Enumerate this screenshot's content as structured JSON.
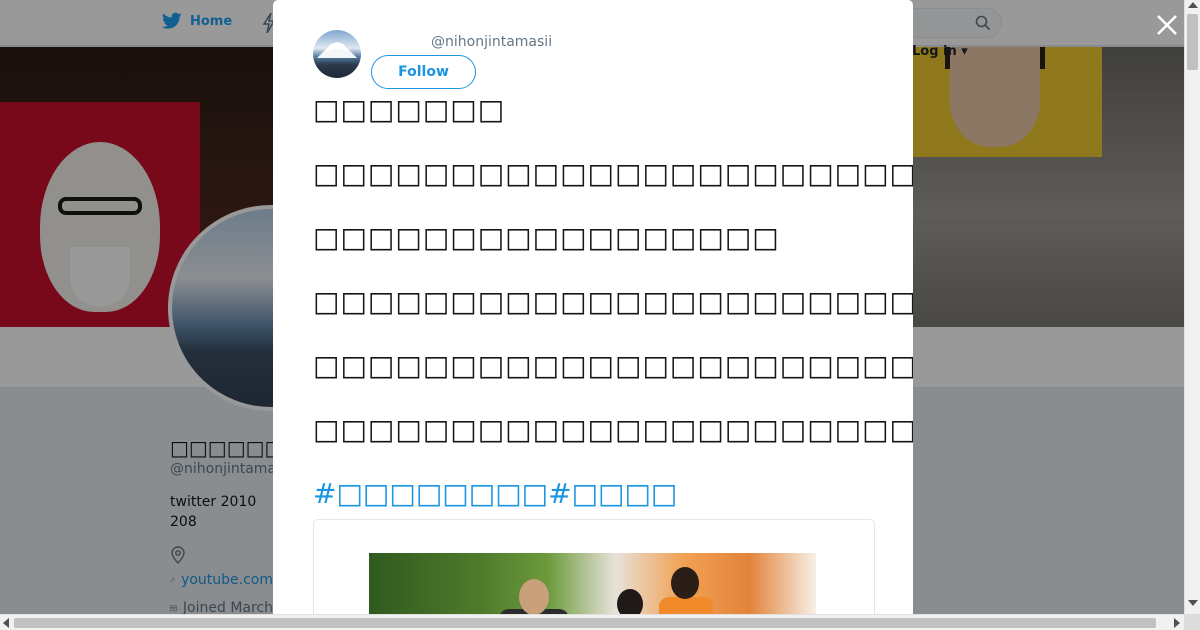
{
  "nav": {
    "home_label": "Home",
    "login_label": "Log in",
    "icons": [
      "twitter-bird-icon",
      "lightning-icon",
      "search-icon",
      "caret-down-icon"
    ]
  },
  "profile": {
    "name": "□□□□□□□□□",
    "handle": "@nihonjintamasii",
    "bio_line1": "twitter 2010",
    "bio_line2": "208",
    "website": "youtube.com",
    "joined": "Joined March"
  },
  "modal": {
    "handle": "@nihonjintamasii",
    "follow_label": "Follow",
    "tweet_lines": [
      "□□□□□□□",
      "□□□□□□□□□□□□□□□□□□□□□□",
      "□□□□□□□□□□□□□□□□□",
      "□□□□□□□□□□□□□□□□□□□□□□□□□□□□",
      "□□□□□□□□□□□□□□□□□□□□□□□□□□□□□□□□□□□",
      "□□□□□□□□□□□□□□□□□□□□□□□□□□□□□□□□□□□□"
    ],
    "hashtags": [
      "#□□□□□□□□",
      "#□□□□"
    ]
  },
  "colors": {
    "accent": "#1b95e0",
    "twitter_blue": "#1da1f2",
    "overlay": "rgba(0,0,0,0.4)"
  }
}
